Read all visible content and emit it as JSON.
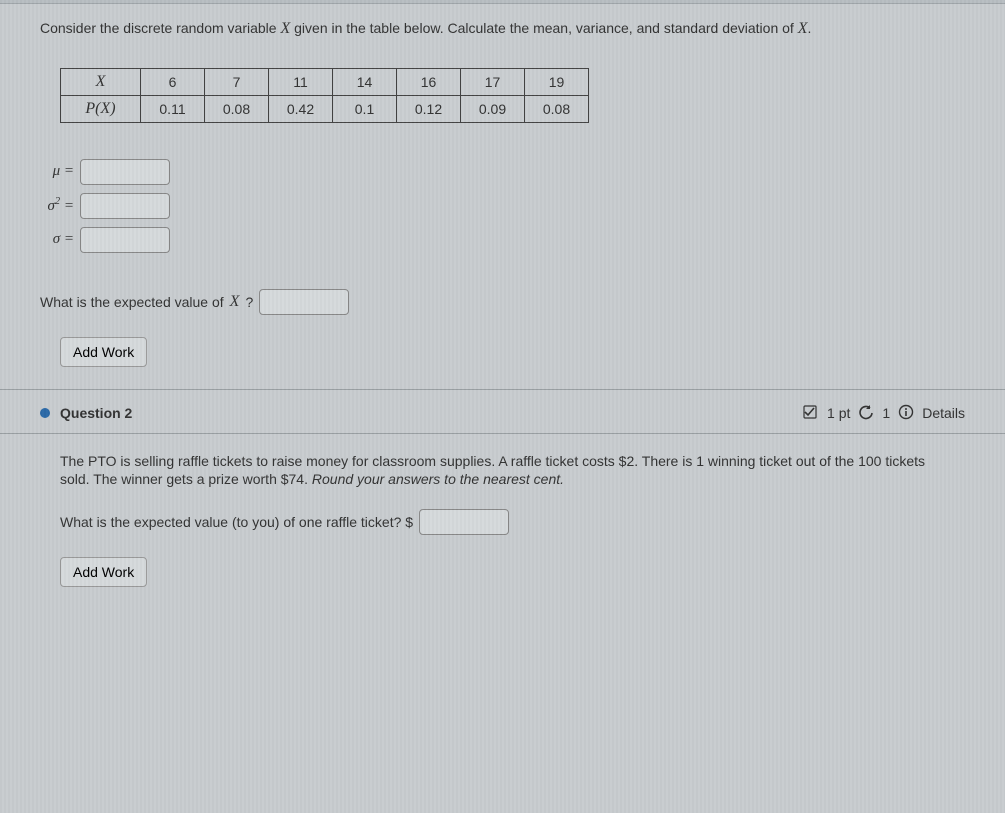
{
  "q1": {
    "prompt_a": "Consider the discrete random variable ",
    "prompt_var": "X",
    "prompt_b": " given in the table below. Calculate the mean, variance, and standard deviation of ",
    "prompt_c": ".",
    "table": {
      "row1_hdr": "X",
      "row2_hdr": "P(X)",
      "x": [
        "6",
        "7",
        "11",
        "14",
        "16",
        "17",
        "19"
      ],
      "p": [
        "0.11",
        "0.08",
        "0.42",
        "0.1",
        "0.12",
        "0.09",
        "0.08"
      ]
    },
    "mu_label": "μ =",
    "sigma2_label_a": "σ",
    "sigma2_label_b": " =",
    "sigma_label": "σ =",
    "mu_val": "",
    "sigma2_val": "",
    "sigma_val": "",
    "expected_q_a": "What is the expected value of ",
    "expected_q_b": "?",
    "expected_val": "",
    "add_work": "Add Work"
  },
  "q2": {
    "title": "Question 2",
    "pts": "1 pt",
    "attempts": "1",
    "details": "Details",
    "body_a": "The PTO is selling raffle tickets to raise money for classroom supplies. A raffle ticket costs $2. There is 1 winning ticket out of the 100 tickets sold. The winner gets a prize worth $74. ",
    "body_b": "Round your answers to the nearest cent.",
    "ev_q": "What is the expected value (to you) of one raffle ticket? $",
    "ev_val": "",
    "add_work": "Add Work"
  }
}
